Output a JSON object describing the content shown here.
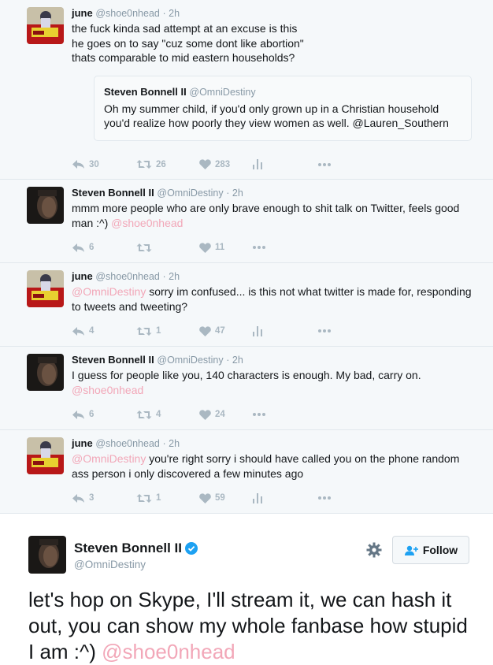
{
  "colors": {
    "mention": "#f2a7b8",
    "muted": "#8899a6",
    "icon": "#aab8c2",
    "verified": "#1da1f2"
  },
  "tweets": [
    {
      "avatar": "june-avatar",
      "name": "june",
      "handle": "@shoe0nhead",
      "time": "· 2h",
      "lines": [
        "the fuck kinda sad attempt at an excuse is this",
        "he goes on to say \"cuz some dont like abortion\"",
        "thats comparable to mid eastern households?"
      ],
      "quote": {
        "name": "Steven Bonnell II",
        "handle": "@OmniDestiny",
        "text": "Oh my summer child, if you'd only grown up in a Christian household you'd realize how poorly they view women as well. @Lauren_Southern"
      },
      "replies": "30",
      "retweets": "26",
      "likes": "283"
    },
    {
      "avatar": "steven-avatar",
      "name": "Steven Bonnell II",
      "handle": "@OmniDestiny",
      "time": "· 2h",
      "text": "mmm more people who are only brave enough to shit talk on Twitter, feels good man :^) ",
      "mention_after": "@shoe0nhead",
      "replies": "6",
      "retweets": "",
      "likes": "11"
    },
    {
      "avatar": "june-avatar",
      "name": "june",
      "handle": "@shoe0nhead",
      "time": "· 2h",
      "mention_before": "@OmniDestiny",
      "text": " sorry im confused... is this not what twitter is made for, responding to tweets and tweeting?",
      "replies": "4",
      "retweets": "1",
      "likes": "47"
    },
    {
      "avatar": "steven-avatar",
      "name": "Steven Bonnell II",
      "handle": "@OmniDestiny",
      "time": "· 2h",
      "text": "I guess for people like you, 140 characters is enough. My bad, carry on.",
      "mention_newline": "@shoe0nhead",
      "replies": "6",
      "retweets": "4",
      "likes": "24"
    },
    {
      "avatar": "june-avatar",
      "name": "june",
      "handle": "@shoe0nhead",
      "time": "· 2h",
      "mention_before": "@OmniDestiny",
      "text": " you're right sorry i should have called you on the phone random ass person i only discovered a few minutes ago",
      "replies": "3",
      "retweets": "1",
      "likes": "59"
    }
  ],
  "main_tweet": {
    "name": "Steven Bonnell II",
    "handle": "@OmniDestiny",
    "follow_label": "Follow",
    "text": "let's hop on Skype, I'll stream it, we can hash it out, you can show my whole fanbase how stupid I am :^) ",
    "mention": "@shoe0nhead"
  }
}
